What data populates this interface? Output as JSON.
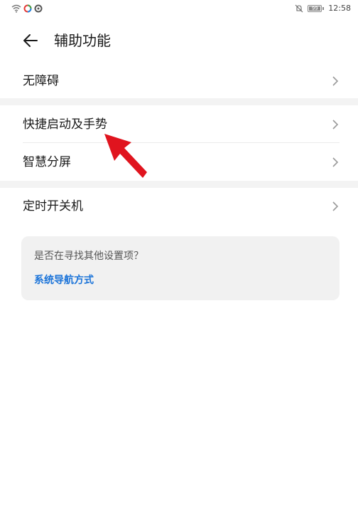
{
  "status_bar": {
    "time": "12:58",
    "battery_level": "99",
    "icons": [
      "wifi-icon",
      "app-notification-icon",
      "app-notification-icon",
      "mute-icon"
    ]
  },
  "header": {
    "title": "辅助功能",
    "back_icon": "back-arrow-icon"
  },
  "menu": {
    "items": [
      {
        "label": "无障碍"
      },
      {
        "label": "快捷启动及手势"
      },
      {
        "label": "智慧分屏"
      },
      {
        "label": "定时开关机"
      }
    ],
    "chevron_icon": "chevron-right-icon"
  },
  "suggestion": {
    "question": "是否在寻找其他设置项？",
    "link": "系统导航方式",
    "link_color": "#1a73d9"
  },
  "annotation": {
    "arrow_color": "#e0141e",
    "points_to": "快捷启动及手势"
  }
}
